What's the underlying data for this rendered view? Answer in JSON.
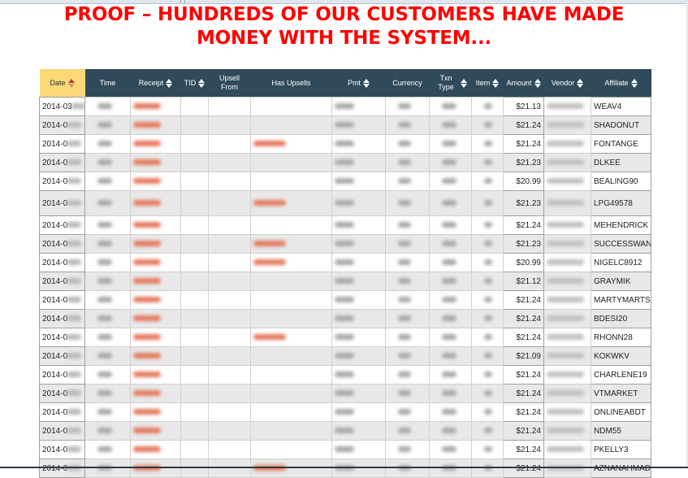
{
  "headline": {
    "line1": "PROOF – HUNDREDS OF OUR CUSTOMERS HAVE MADE",
    "line2": "MONEY WITH THE SYSTEM..."
  },
  "table": {
    "columns": [
      {
        "key": "date",
        "label": "Date",
        "sortable": true,
        "active": true
      },
      {
        "key": "time",
        "label": "Time",
        "sortable": false
      },
      {
        "key": "receipt",
        "label": "Receipt",
        "sortable": true
      },
      {
        "key": "tid",
        "label": "TID",
        "sortable": true
      },
      {
        "key": "upsell_from",
        "label": "Upsell From",
        "sortable": false
      },
      {
        "key": "has_upsells",
        "label": "Has Upsells",
        "sortable": false
      },
      {
        "key": "pmt",
        "label": "Pmt",
        "sortable": true
      },
      {
        "key": "currency",
        "label": "Currency",
        "sortable": false
      },
      {
        "key": "txn_type",
        "label": "Txn Type",
        "sortable": true
      },
      {
        "key": "item",
        "label": "Item",
        "sortable": true
      },
      {
        "key": "amount",
        "label": "Amount",
        "sortable": true
      },
      {
        "key": "vendor",
        "label": "Vendor",
        "sortable": true
      },
      {
        "key": "affiliate",
        "label": "Affiliate",
        "sortable": true
      }
    ],
    "blurred_note": "Time, Receipt, TID, Upsell From, Has Upsells, Pmt, Currency, Txn Type, Item, Vendor and part of Date are blurred",
    "rows": [
      {
        "date": "2014-03",
        "amount": "$21.13",
        "affiliate": "WEAV4",
        "has_upsells": false
      },
      {
        "date": "2014-0",
        "amount": "$21.24",
        "affiliate": "SHADONUT",
        "has_upsells": false
      },
      {
        "date": "2014-0",
        "amount": "$21.24",
        "affiliate": "FONTANGE",
        "has_upsells": true
      },
      {
        "date": "2014-0",
        "amount": "$21.23",
        "affiliate": "DLKEE",
        "has_upsells": false
      },
      {
        "date": "2014-0",
        "amount": "$20.99",
        "affiliate": "BEALING90",
        "has_upsells": false
      },
      {
        "date": "2014-0",
        "amount": "$21.23",
        "affiliate": "LPG49578",
        "has_upsells": true
      },
      {
        "date": "2014-0",
        "amount": "$21.24",
        "affiliate": "MEHENDRICK",
        "has_upsells": false
      },
      {
        "date": "2014-0",
        "amount": "$21.23",
        "affiliate": "SUCCESSWAN",
        "has_upsells": true
      },
      {
        "date": "2014-0",
        "amount": "$20.99",
        "affiliate": "NIGELC8912",
        "has_upsells": true
      },
      {
        "date": "2014-0",
        "amount": "$21.12",
        "affiliate": "GRAYMIK",
        "has_upsells": false
      },
      {
        "date": "2014-0",
        "amount": "$21.24",
        "affiliate": "MARTYMARTS",
        "has_upsells": false
      },
      {
        "date": "2014-0",
        "amount": "$21.24",
        "affiliate": "BDESI20",
        "has_upsells": false
      },
      {
        "date": "2014-0",
        "amount": "$21.24",
        "affiliate": "RHONN28",
        "has_upsells": true
      },
      {
        "date": "2014-0",
        "amount": "$21.09",
        "affiliate": "KOKWKV",
        "has_upsells": false
      },
      {
        "date": "2014-0",
        "amount": "$21.24",
        "affiliate": "CHARLENE19",
        "has_upsells": false
      },
      {
        "date": "2014-0",
        "amount": "$21.24",
        "affiliate": "VTMARKET",
        "has_upsells": false
      },
      {
        "date": "2014-0",
        "amount": "$21.24",
        "affiliate": "ONLINEABDT",
        "has_upsells": false
      },
      {
        "date": "2014-0",
        "amount": "$21.24",
        "affiliate": "NDM55",
        "has_upsells": false
      },
      {
        "date": "2014-0",
        "amount": "$21.24",
        "affiliate": "PKELLY3",
        "has_upsells": false
      },
      {
        "date": "2014-0",
        "amount": "$21.24",
        "affiliate": "AZNANAHMAD",
        "has_upsells": true
      }
    ]
  },
  "colors": {
    "headline": "#ff0000",
    "header_bg": "#2f4a5a",
    "active_header_bg": "#fbd977",
    "row_alt_bg": "#e8e8e8"
  }
}
